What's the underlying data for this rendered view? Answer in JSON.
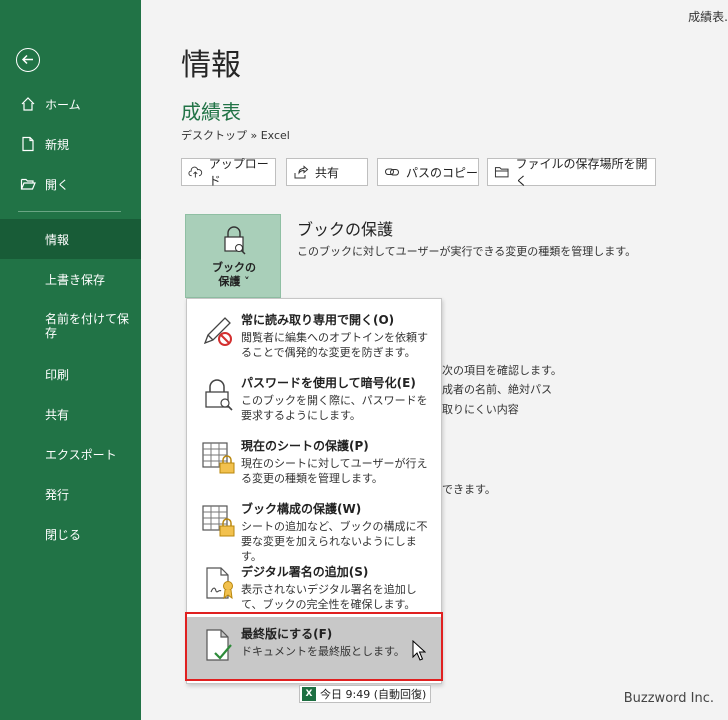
{
  "window_title": "成績表.",
  "sidebar": {
    "items": [
      {
        "label": "ホーム"
      },
      {
        "label": "新規"
      },
      {
        "label": "開く"
      },
      {
        "label": "情報"
      },
      {
        "label": "上書き保存"
      },
      {
        "label": "名前を付けて保存"
      },
      {
        "label": "印刷"
      },
      {
        "label": "共有"
      },
      {
        "label": "エクスポート"
      },
      {
        "label": "発行"
      },
      {
        "label": "閉じる"
      }
    ],
    "active": "情報",
    "accent_color": "#217346",
    "active_color": "#185c37"
  },
  "main": {
    "title": "情報",
    "doc_name": "成績表",
    "path": "デスクトップ » Excel",
    "buttons": [
      {
        "label": "アップロード",
        "icon": "cloud-upload-icon"
      },
      {
        "label": "共有",
        "icon": "share-icon"
      },
      {
        "label": "パスのコピー",
        "icon": "link-icon"
      },
      {
        "label": "ファイルの保存場所を開く",
        "icon": "folder-icon"
      }
    ],
    "protect": {
      "tile_line1": "ブックの",
      "tile_line2": "保護 ˅",
      "heading": "ブックの保護",
      "description": "このブックに対してユーザーが実行できる変更の種類を管理します。"
    },
    "background_lines": [
      "の次の項目を確認します。",
      "作成者の名前、絶対パス",
      "み取りにくい内容",
      "ができます。"
    ]
  },
  "dropdown": {
    "items": [
      {
        "title": "常に読み取り専用で開く(O)",
        "desc": "閲覧者に編集へのオプトインを依頼することで偶発的な変更を防ぎます。",
        "icon": "pencil-no-icon"
      },
      {
        "title": "パスワードを使用して暗号化(E)",
        "desc": "このブックを開く際に、パスワードを要求するようにします。",
        "icon": "lock-key-icon"
      },
      {
        "title": "現在のシートの保護(P)",
        "desc": "現在のシートに対してユーザーが行える変更の種類を管理します。",
        "icon": "sheet-lock-icon"
      },
      {
        "title": "ブック構成の保護(W)",
        "desc": "シートの追加など、ブックの構成に不要な変更を加えられないようにします。",
        "icon": "workbook-lock-icon"
      },
      {
        "title": "デジタル署名の追加(S)",
        "desc": "表示されないデジタル署名を追加して、ブックの完全性を確保します。",
        "icon": "signature-icon"
      },
      {
        "title": "最終版にする(F)",
        "desc": "ドキュメントを最終版とします。",
        "icon": "document-check-icon"
      }
    ],
    "highlighted_index": 5,
    "highlight_color": "#e02020"
  },
  "autosave": {
    "label": "今日 9:49 (自動回復)",
    "badge": "X"
  },
  "watermark": "Buzzword Inc."
}
